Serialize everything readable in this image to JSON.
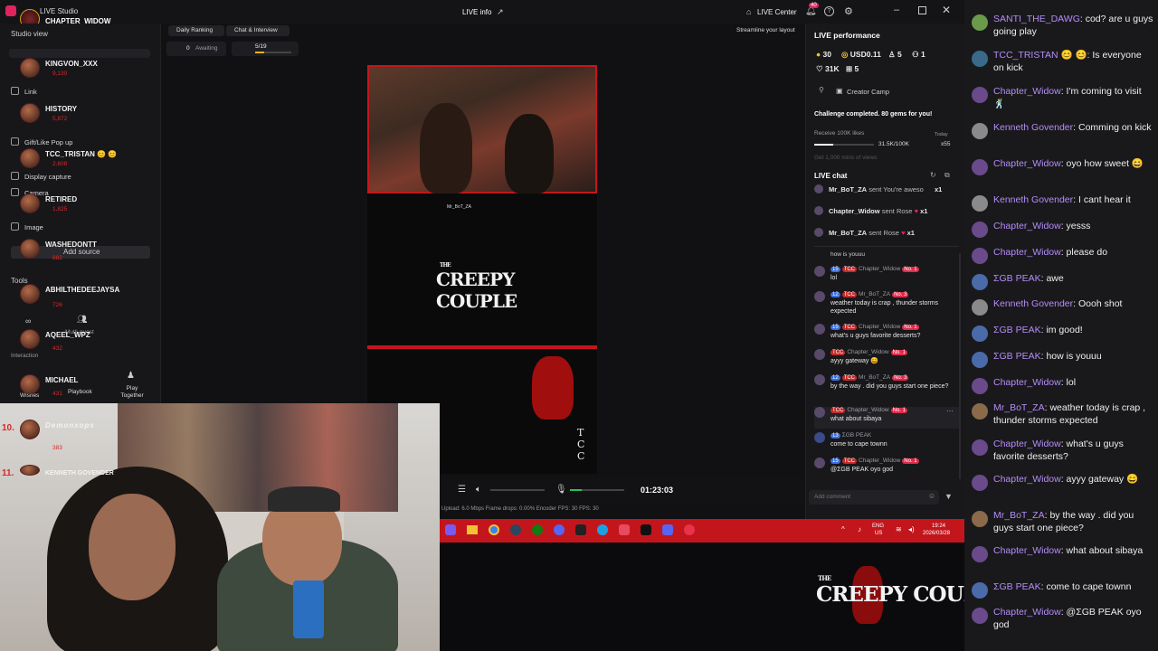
{
  "titlebar": {
    "app_name": "LIVE Studio",
    "user": "CHAPTER_WIDOW",
    "center_title": "LIVE info",
    "live_center": "LIVE Center",
    "notif_count": "40"
  },
  "left_panel": {
    "studio_view": "Studio view",
    "menu": [
      "Link",
      "Gift/Like Pop up",
      "Display capture",
      "Camera",
      "Image"
    ],
    "add_source": "Add source",
    "tools": "Tools",
    "multi_guest": "Multi-guest",
    "interaction": "Interaction",
    "wishes": "Wishes",
    "playbook": "Playbook",
    "play_together": "Play Together"
  },
  "leaderboard": [
    {
      "name": "KINGVON_XXX",
      "sub": "9,130"
    },
    {
      "name": "HISTORY",
      "sub": "5,872"
    },
    {
      "name": "TCC_TRISTAN 😊 😊",
      "sub": "2,608"
    },
    {
      "name": "RETIRED",
      "sub": "1,825"
    },
    {
      "name": "WASHEDONTT",
      "sub": "882"
    },
    {
      "name": "ABHILTHEDEEJAYSA",
      "sub": "726"
    },
    {
      "name": "AQEEL_WPZ",
      "sub": "432"
    },
    {
      "name": "MICHAEL",
      "sub": "431"
    },
    {
      "name": "Demonxops",
      "sub": "383"
    },
    {
      "name": "KENNETH GOVENDER",
      "sub": ""
    }
  ],
  "leaderboard_ranks": [
    "10.",
    "11."
  ],
  "top_tabs": {
    "daily_ranking": "Daily Ranking",
    "chat_interview": "Chat & Interview",
    "awaiting_count": "0",
    "awaiting_label": "Awaiting",
    "progress": "5/19",
    "streamline": "Streamline your layout"
  },
  "controls": {
    "timer": "01:23:03",
    "stats": "Upload: 6.0 Mbps   Frame drops: 0.00%   Encoder FPS: 30   FPS: 30"
  },
  "taskbar": {
    "lang": "ENG",
    "region": "US",
    "time": "19:24",
    "date": "2026/03/28"
  },
  "performance": {
    "title": "LIVE performance",
    "coins": "30",
    "usd": "USD0.11",
    "viewers": "5",
    "extra": "1",
    "likes": "31K",
    "shares": "5",
    "creator_camp": "Creator Camp",
    "challenge": "Challenge completed. 80 gems for you!",
    "receive": "Receive 100K likes",
    "today": "Today",
    "likes_progress": "31.5K/100K",
    "multiplier": "x55",
    "get_more": "Get 1,000 mins of views"
  },
  "live_chat": {
    "title": "LIVE chat",
    "gifts": [
      {
        "user": "Mr_BoT_ZA",
        "action": "sent You're aweso",
        "count": "x1"
      },
      {
        "user": "Chapter_Widow",
        "action": "sent Rose",
        "count": "x1"
      },
      {
        "user": "Mr_BoT_ZA",
        "action": "sent Rose",
        "count": "x1"
      }
    ],
    "partial": "how is youuu",
    "messages": [
      {
        "level": "15",
        "user": "Chapter_Widow",
        "rank": "No. 1",
        "text": "lol"
      },
      {
        "level": "12",
        "user": "Mr_BoT_ZA",
        "rank": "No. 3",
        "text": "weather today is crap , thunder storms expected"
      },
      {
        "level": "15",
        "user": "Chapter_Widow",
        "rank": "No. 1",
        "text": "what's u guys favorite desserts?"
      },
      {
        "level": "",
        "user": "Chapter_Widow",
        "rank": "No. 1",
        "text": "ayyy gateway 😄"
      },
      {
        "level": "12",
        "user": "Mr_BoT_ZA",
        "rank": "No. 3",
        "text": "by the way . did you guys start one piece?"
      },
      {
        "level": "",
        "user": "Chapter_Widow",
        "rank": "No. 1",
        "text": "what about sibaya"
      },
      {
        "level": "13",
        "user": "ΣGB PEAK",
        "rank": "",
        "text": "come to cape townn"
      },
      {
        "level": "15",
        "user": "Chapter_Widow",
        "rank": "No. 1",
        "text": "@ΣGB PEAK oyo god"
      }
    ],
    "placeholder": "Add comment"
  },
  "preview": {
    "brand_line1": "THE",
    "brand_line2": "CREEPY COUPLE",
    "side_letters": "TCC",
    "overlay_user": "Mr_BoT_ZA"
  },
  "branding": {
    "the": "THE",
    "name": "CREEPY COUPLE"
  },
  "stream_chat": [
    {
      "user": "SANTI_THE_DAWG",
      "text": "cod? are u guys going play",
      "color": "#6a9a4a"
    },
    {
      "user": "TCC_TRISTAN 😊 😊",
      "text": "Is everyone on kick",
      "color": "#3a6a8a"
    },
    {
      "user": "Chapter_Widow",
      "text": "I'm coming to visit 🕺",
      "color": "#6a4a8a"
    },
    {
      "user": "Kenneth Govender",
      "text": "Comming on kick",
      "color": "#8a8a8a"
    },
    {
      "user": "Chapter_Widow",
      "text": "oyo how sweet 😄",
      "color": "#6a4a8a"
    },
    {
      "user": "Kenneth Govender",
      "text": "I cant hear it",
      "color": "#8a8a8a"
    },
    {
      "user": "Chapter_Widow",
      "text": "yesss",
      "color": "#6a4a8a"
    },
    {
      "user": "Chapter_Widow",
      "text": "please do",
      "color": "#6a4a8a"
    },
    {
      "user": "ΣGB PEAK",
      "text": "awe",
      "color": "#4a6aaa"
    },
    {
      "user": "Kenneth Govender",
      "text": "Oooh shot",
      "color": "#8a8a8a"
    },
    {
      "user": "ΣGB PEAK",
      "text": "im good!",
      "color": "#4a6aaa"
    },
    {
      "user": "ΣGB PEAK",
      "text": "how is youuu",
      "color": "#4a6aaa"
    },
    {
      "user": "Chapter_Widow",
      "text": "lol",
      "color": "#6a4a8a"
    },
    {
      "user": "Mr_BoT_ZA",
      "text": "weather today is crap , thunder storms expected",
      "color": "#8a6a4a"
    },
    {
      "user": "Chapter_Widow",
      "text": "what's u guys favorite desserts?",
      "color": "#6a4a8a"
    },
    {
      "user": "Chapter_Widow",
      "text": "ayyy gateway 😄",
      "color": "#6a4a8a"
    },
    {
      "user": "Mr_BoT_ZA",
      "text": "by the way . did you guys start one piece?",
      "color": "#8a6a4a"
    },
    {
      "user": "Chapter_Widow",
      "text": "what about sibaya",
      "color": "#6a4a8a"
    },
    {
      "user": "ΣGB PEAK",
      "text": "come to cape townn",
      "color": "#4a6aaa"
    },
    {
      "user": "Chapter_Widow",
      "text": "@ΣGB PEAK oyo god",
      "color": "#6a4a8a"
    }
  ],
  "colors": {
    "accent_red": "#c3161c",
    "chat_user": "#b58df7",
    "live_blue": "#3b6ee0"
  }
}
